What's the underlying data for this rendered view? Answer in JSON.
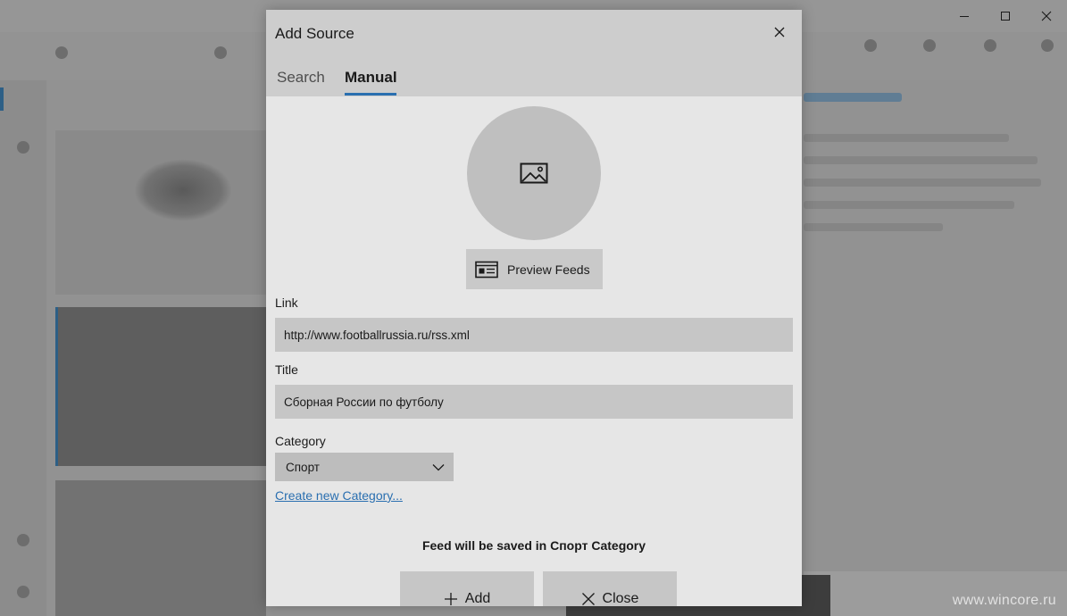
{
  "window": {
    "controls": {
      "minimize_icon": "minimize-icon",
      "maximize_icon": "maximize-icon",
      "close_icon": "close-icon"
    }
  },
  "dialog": {
    "title": "Add Source",
    "close_icon": "close-icon",
    "tabs": [
      {
        "label": "Search",
        "active": false
      },
      {
        "label": "Manual",
        "active": true
      }
    ],
    "image_placeholder_icon": "image-icon",
    "preview_button": {
      "label": "Preview Feeds",
      "icon": "newspaper-icon"
    },
    "link": {
      "label": "Link",
      "value": "http://www.footballrussia.ru/rss.xml"
    },
    "title_field": {
      "label": "Title",
      "value": "Сборная России по футболу"
    },
    "category": {
      "label": "Category",
      "selected": "Спорт",
      "icon": "chevron-down-icon"
    },
    "create_category_link": "Create new Category...",
    "save_note": "Feed will be saved in Спорт Category",
    "buttons": {
      "add": {
        "label": "Add",
        "icon": "plus-icon"
      },
      "close": {
        "label": "Close",
        "icon": "close-icon"
      }
    }
  },
  "colors": {
    "accent": "#2a6fb0",
    "dialog_bg": "#e6e6e6",
    "header_bg": "#cdcdcd",
    "input_bg": "#c6c6c6"
  },
  "watermark": "www.wincore.ru"
}
